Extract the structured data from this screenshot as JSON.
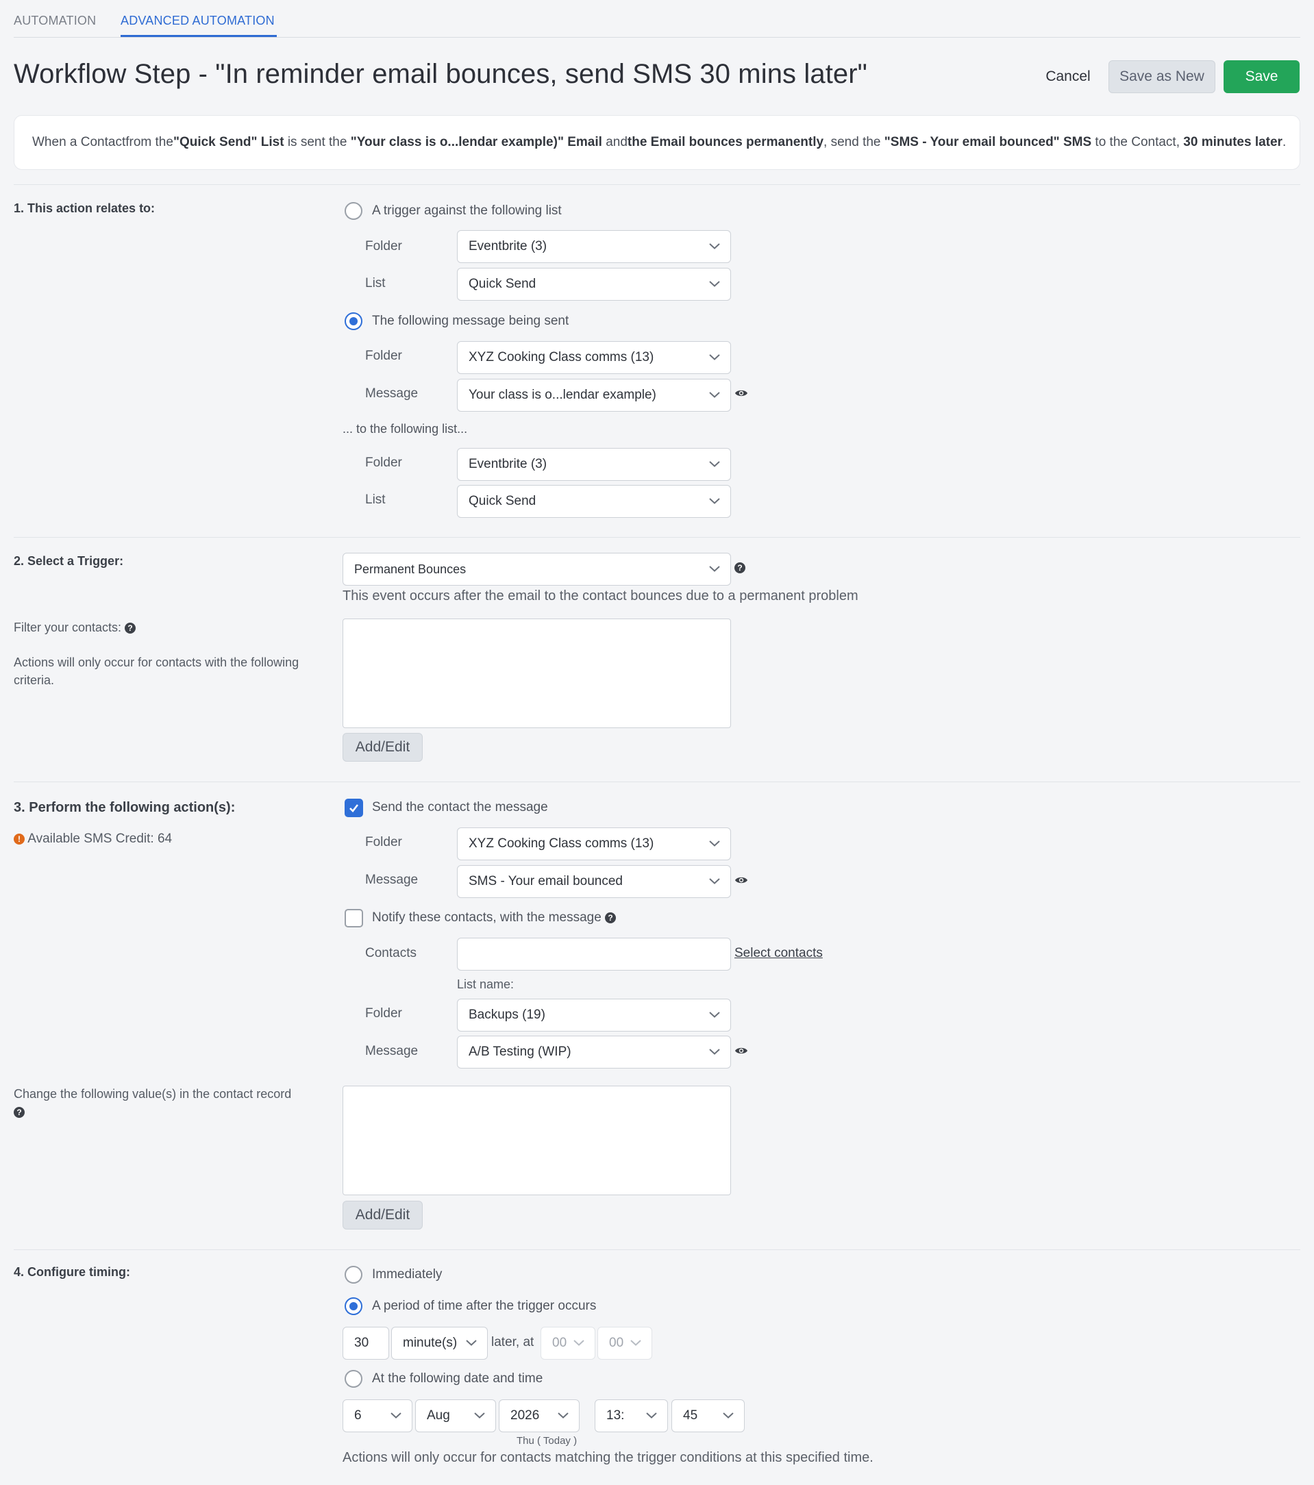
{
  "tabs": {
    "automation": "AUTOMATION",
    "advanced": "ADVANCED AUTOMATION"
  },
  "header": {
    "title": "Workflow Step - \"In reminder email bounces, send SMS 30 mins later\"",
    "cancel": "Cancel",
    "save_as_new": "Save as New",
    "save": "Save"
  },
  "summary": {
    "p1": "When a Contactfrom the ",
    "b1": "\"Quick Send\" List",
    "p2": " is sent the ",
    "b2": "\"Your class is o...lendar example)\" Email",
    "p3": " and",
    "b3": "the Email bounces permanently",
    "p4": ", send the ",
    "b4": "\"SMS - Your email bounced\" SMS",
    "p5": " to the Contact, ",
    "b5": "30 minutes later",
    "p6": "."
  },
  "section1": {
    "title": "1. This action relates to:",
    "opt_list": "A trigger against the following list",
    "folder_label": "Folder",
    "list_label": "List",
    "message_label": "Message",
    "list_folder": "Eventbrite (3)",
    "list_value": "Quick Send",
    "opt_message": "The following message being sent",
    "msg_folder": "XYZ Cooking Class comms (13)",
    "msg_value": "Your class is o...lendar example)",
    "to_list_text": "... to the following list...",
    "to_folder": "Eventbrite (3)",
    "to_list": "Quick Send"
  },
  "section2": {
    "title": "2. Select a Trigger:",
    "trigger": "Permanent Bounces",
    "trigger_desc": "This event occurs after the email to the contact bounces due to a permanent problem",
    "filter_label": "Filter your contacts:",
    "filter_desc": "Actions will only occur for contacts with the following criteria.",
    "add_edit": "Add/Edit"
  },
  "section3": {
    "title": "3. Perform the following action(s):",
    "credit": "Available SMS Credit: 64",
    "send_label": "Send the contact the message",
    "folder_label": "Folder",
    "message_label": "Message",
    "send_folder": "XYZ Cooking Class comms (13)",
    "send_message": "SMS - Your email bounced",
    "notify_label": "Notify these contacts, with the message",
    "contacts_label": "Contacts",
    "contacts_value": "",
    "select_contacts": "Select contacts",
    "list_name": "List name:",
    "notify_folder": "Backups (19)",
    "notify_message": "A/B Testing (WIP)",
    "change_label": "Change the following value(s) in the contact record",
    "add_edit": "Add/Edit"
  },
  "section4": {
    "title": "4. Configure timing:",
    "opt_immediately": "Immediately",
    "opt_period": "A period of time after the trigger occurs",
    "period_value": "30",
    "period_unit": "minute(s)",
    "later_at": "later, at",
    "hour": "00",
    "minute": "00",
    "opt_date": "At the following date and time",
    "day": "6",
    "month": "Aug",
    "year": "2026",
    "time_h": "13:",
    "time_m": "45",
    "date_note": "Thu ( Today )",
    "footer": "Actions will only occur for contacts matching the trigger conditions at this specified time."
  }
}
